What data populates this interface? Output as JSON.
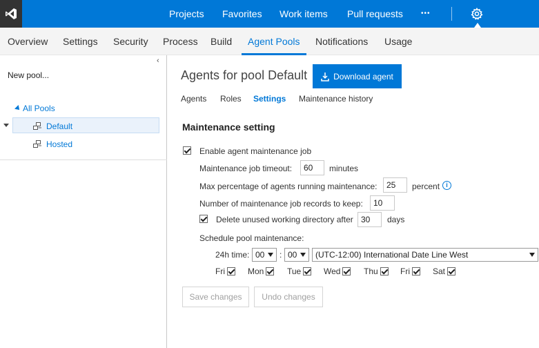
{
  "topbar": {
    "nav": [
      "Projects",
      "Favorites",
      "Work items",
      "Pull requests",
      "•••"
    ],
    "accent": "#0078d7"
  },
  "subnav": {
    "tabs": [
      "Overview",
      "Settings",
      "Security",
      "Process",
      "Build",
      "Agent Pools",
      "Notifications",
      "Usage"
    ],
    "active": "Agent Pools"
  },
  "sidebar": {
    "new_pool": "New pool...",
    "all_pools": "All Pools",
    "pools": [
      "Default",
      "Hosted"
    ],
    "collapse_glyph": "‹"
  },
  "main": {
    "title": "Agents for pool Default",
    "download_label": "Download agent",
    "tabs": [
      "Agents",
      "Roles",
      "Settings",
      "Maintenance history"
    ],
    "active_tab": "Settings"
  },
  "maintenance": {
    "section_title": "Maintenance setting",
    "enable_label": "Enable agent maintenance job",
    "timeout_label": "Maintenance job timeout:",
    "timeout_value": "60",
    "timeout_unit": "minutes",
    "max_pct_label": "Max percentage of agents running maintenance:",
    "max_pct_value": "25",
    "max_pct_unit": "percent",
    "records_label": "Number of maintenance job records to keep:",
    "records_value": "10",
    "delete_label": "Delete unused working directory after",
    "delete_value": "30",
    "delete_unit": "days",
    "schedule_label": "Schedule pool maintenance:",
    "time_label": "24h time:",
    "hour": "00",
    "minute": "00",
    "time_sep": ":",
    "timezone": "(UTC-12:00) International Date Line West",
    "days": [
      "Fri",
      "Mon",
      "Tue",
      "Wed",
      "Thu",
      "Fri",
      "Sat"
    ],
    "save_label": "Save changes",
    "undo_label": "Undo changes"
  }
}
